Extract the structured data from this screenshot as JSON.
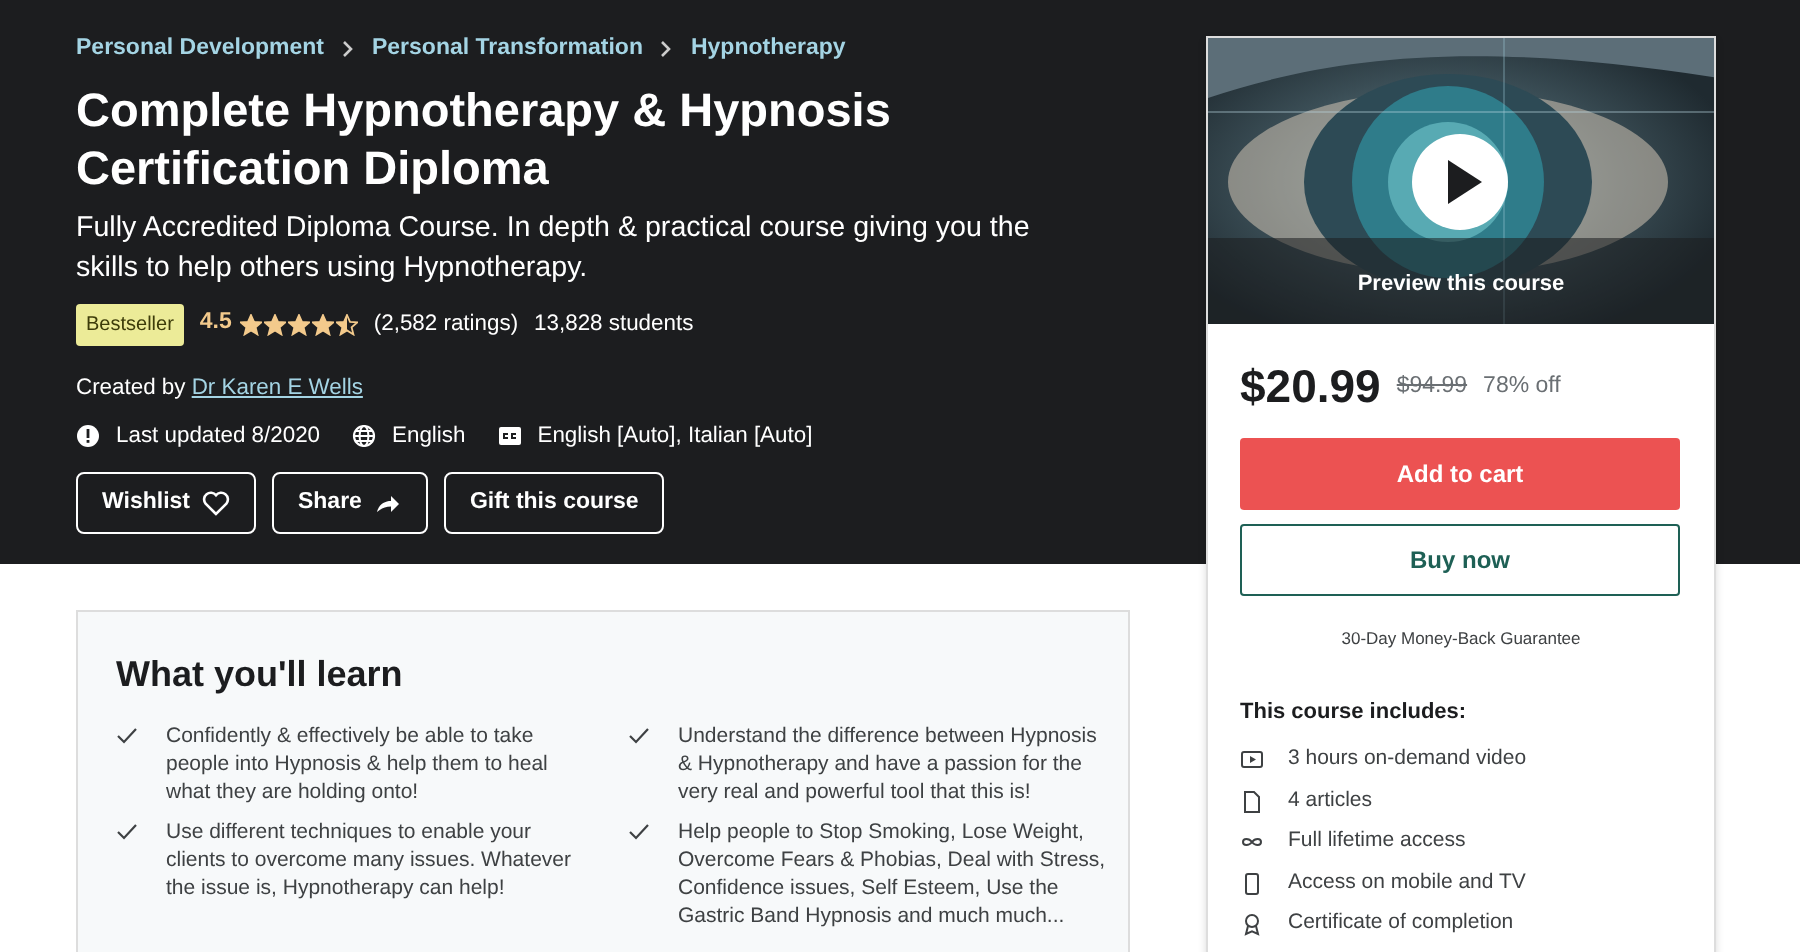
{
  "header": {
    "breadcrumbs": [
      "Personal Development",
      "Personal Transformation",
      "Hypnotherapy"
    ],
    "title": "Complete Hypnotherapy & Hypnosis Certification Diploma",
    "subtitle": "Fully Accredited Diploma Course. In depth & practical course giving you the skills to help others using Hypnotherapy.",
    "badge": "Bestseller",
    "rating": "4.5",
    "stars": 4.5,
    "ratings_count": "(2,582 ratings)",
    "students": "13,828 students",
    "created_by_label": "Created by",
    "author": "Dr Karen E Wells",
    "meta": [
      {
        "kind": "updated",
        "text": "Last updated 8/2020"
      },
      {
        "kind": "language",
        "text": "English"
      },
      {
        "kind": "captions",
        "text": "English [Auto], Italian [Auto]"
      }
    ],
    "buttons": [
      {
        "label": "Wishlist",
        "kind": "heart"
      },
      {
        "label": "Share",
        "kind": "share"
      },
      {
        "label": "Gift this course",
        "kind": "plain"
      }
    ]
  },
  "learn": {
    "title": "What you'll learn",
    "items": [
      "Confidently & effectively be able to take people into Hypnosis & help them to heal what they are holding onto!",
      "Understand the difference between Hypnosis & Hypnotherapy and have a passion for the very real and powerful tool that this is!",
      "Use different techniques to enable your clients to overcome many issues. Whatever the issue is, Hypnotherapy can help!",
      "Help people to Stop Smoking, Lose Weight, Overcome Fears & Phobias, Deal with Stress, Confidence issues, Self Esteem, Use the Gastric Band Hypnosis and much much..."
    ]
  },
  "sidebar": {
    "preview": {
      "kind": "picture",
      "label": "Preview this course"
    },
    "price": "$20.99",
    "original_price": "$94.99",
    "discount": "78% off",
    "add_to_cart": "Add to cart",
    "buy_now": "Buy now",
    "guarantee": "30-Day Money-Back Guarantee",
    "includes_title": "This course includes:",
    "includes": [
      {
        "kind": "video",
        "text": "3 hours on-demand video"
      },
      {
        "kind": "article",
        "text": "4 articles"
      },
      {
        "kind": "infinity",
        "text": "Full lifetime access"
      },
      {
        "kind": "mobile",
        "text": "Access on mobile and TV"
      },
      {
        "kind": "certificate",
        "text": "Certificate of completion"
      }
    ]
  }
}
